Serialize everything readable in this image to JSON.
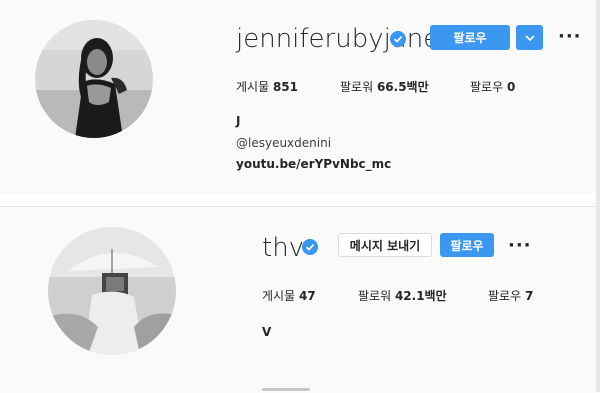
{
  "profiles": [
    {
      "username": "jenniferubyjane",
      "follow_label": "팔로우",
      "stats": {
        "posts_label": "게시물",
        "posts_value": "851",
        "followers_label": "팔로워",
        "followers_value": "66.5백만",
        "following_label": "팔로우",
        "following_value": "0"
      },
      "bio_name": "J",
      "bio_handle": "@lesyeuxdenini",
      "bio_link": "youtu.be/erYPvNbc_mc",
      "avatar": "woman-portrait-bw"
    },
    {
      "username": "thv",
      "message_label": "메시지 보내기",
      "follow_label": "팔로우",
      "stats": {
        "posts_label": "게시물",
        "posts_value": "47",
        "followers_label": "팔로워",
        "followers_value": "42.1백만",
        "following_label": "팔로우",
        "following_value": "7"
      },
      "bio_name": "V",
      "avatar": "man-umbrella-bw"
    }
  ],
  "icons": {
    "verified": "verified-badge-icon",
    "dropdown": "chevron-down-icon",
    "more": "more-options-icon"
  },
  "colors": {
    "accent": "#3b97f0",
    "verified": "#3897f0"
  }
}
